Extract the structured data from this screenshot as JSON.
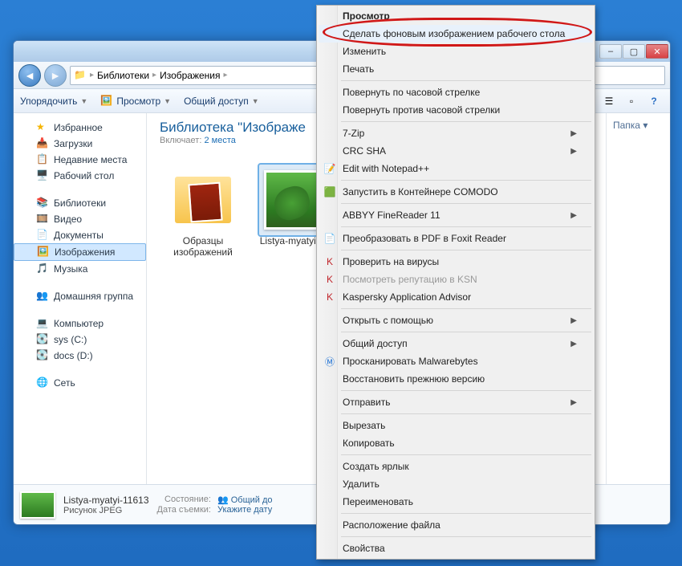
{
  "window": {
    "back_tooltip": "Назад",
    "fwd_tooltip": "Вперёд"
  },
  "breadcrumb": {
    "root_icon": "folder-icon",
    "items": [
      "Библиотеки",
      "Изображения"
    ]
  },
  "toolbar": {
    "organize": "Упорядочить",
    "preview": "Просмотр",
    "share": "Общий доступ"
  },
  "sidebar": {
    "favorites": {
      "label": "Избранное",
      "items": [
        "Загрузки",
        "Недавние места",
        "Рабочий стол"
      ]
    },
    "libraries": {
      "label": "Библиотеки",
      "items": [
        "Видео",
        "Документы",
        "Изображения",
        "Музыка"
      ]
    },
    "homegroup": {
      "label": "Домашняя группа"
    },
    "computer": {
      "label": "Компьютер",
      "items": [
        "sys (C:)",
        "docs (D:)"
      ]
    },
    "network": {
      "label": "Сеть"
    }
  },
  "library_header": {
    "title": "Библиотека \"Изображе",
    "includes_label": "Включает:",
    "includes_link": "2 места"
  },
  "rightpane": {
    "sort_label": "Папка ▾"
  },
  "files": [
    {
      "name": "Образцы изображений",
      "type": "folder",
      "selected": false
    },
    {
      "name": "Listya-myatyi-11613",
      "type": "image",
      "selected": true
    }
  ],
  "details": {
    "name": "Listya-myatyi-11613",
    "type": "Рисунок JPEG",
    "state_label": "Состояние:",
    "state_value": "Общий до",
    "date_label": "Дата съемки:",
    "date_value": "Укажите дату"
  },
  "context_menu": {
    "items": [
      {
        "label": "Просмотр",
        "bold": true
      },
      {
        "label": "Сделать фоновым изображением рабочего стола",
        "highlight": true
      },
      {
        "label": "Изменить"
      },
      {
        "label": "Печать"
      },
      {
        "sep": true
      },
      {
        "label": "Повернуть по часовой стрелке"
      },
      {
        "label": "Повернуть против часовой стрелки"
      },
      {
        "sep": true
      },
      {
        "label": "7-Zip",
        "submenu": true
      },
      {
        "label": "CRC SHA",
        "submenu": true
      },
      {
        "label": "Edit with Notepad++",
        "icon": "📝"
      },
      {
        "sep": true
      },
      {
        "label": "Запустить в Контейнере COMODO",
        "icon": "🟩"
      },
      {
        "sep": true
      },
      {
        "label": "ABBYY FineReader 11",
        "submenu": true
      },
      {
        "sep": true
      },
      {
        "label": "Преобразовать в PDF в Foxit Reader",
        "icon": "📄"
      },
      {
        "sep": true
      },
      {
        "label": "Проверить на вирусы",
        "icon": "K",
        "iconColor": "#c1272d"
      },
      {
        "label": "Посмотреть репутацию в KSN",
        "icon": "K",
        "iconColor": "#c1272d",
        "disabled": true
      },
      {
        "label": "Kaspersky Application Advisor",
        "icon": "K",
        "iconColor": "#c1272d"
      },
      {
        "sep": true
      },
      {
        "label": "Открыть с помощью",
        "submenu": true
      },
      {
        "sep": true
      },
      {
        "label": "Общий доступ",
        "submenu": true
      },
      {
        "label": "Просканировать Malwarebytes",
        "icon": "Ⓜ",
        "iconColor": "#1a6fd4"
      },
      {
        "label": "Восстановить прежнюю версию"
      },
      {
        "sep": true
      },
      {
        "label": "Отправить",
        "submenu": true
      },
      {
        "sep": true
      },
      {
        "label": "Вырезать"
      },
      {
        "label": "Копировать"
      },
      {
        "sep": true
      },
      {
        "label": "Создать ярлык"
      },
      {
        "label": "Удалить"
      },
      {
        "label": "Переименовать"
      },
      {
        "sep": true
      },
      {
        "label": "Расположение файла"
      },
      {
        "sep": true
      },
      {
        "label": "Свойства"
      }
    ]
  }
}
